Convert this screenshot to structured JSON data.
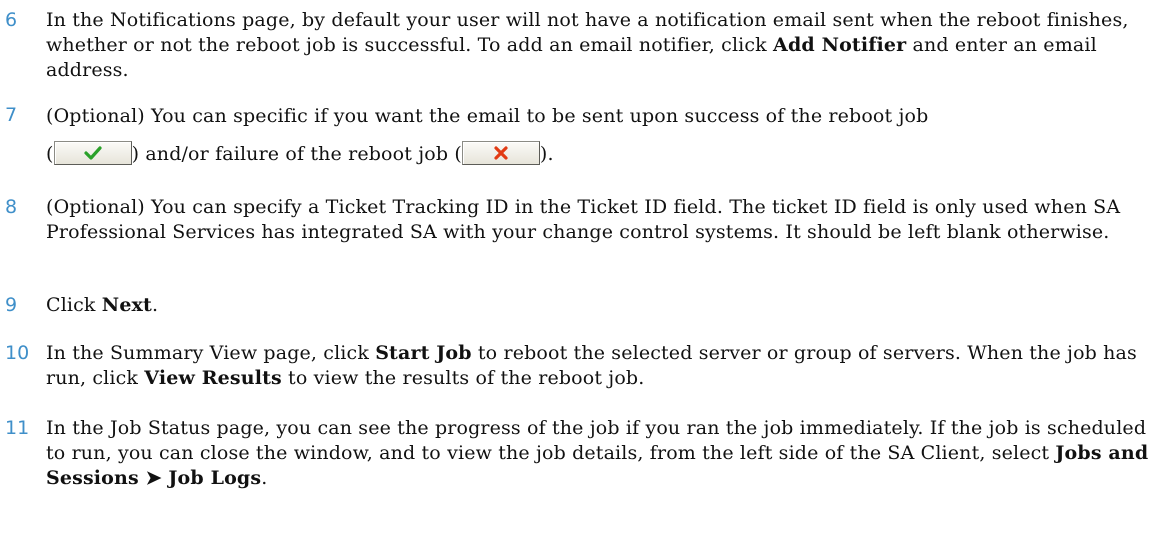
{
  "steps": [
    {
      "number": "6",
      "parts": [
        "In the Notifications page, by default your user will not have a notification email sent when the reboot finishes, whether or not the reboot job is successful. To add an email notifier, click ",
        "Add Notifier",
        " and enter an email address."
      ]
    },
    {
      "number": "7",
      "line1": "(Optional) You can specific if you want the email to be sent upon success of the reboot job",
      "before_success": "(",
      "between": ") and/or failure of the reboot job (",
      "after_failure": ").",
      "success_icon": "checkmark-icon",
      "failure_icon": "x-icon",
      "success_color": "#2aa12a",
      "failure_color": "#e23b14"
    },
    {
      "number": "8",
      "text": "(Optional) You can specify a Ticket Tracking ID in the Ticket ID field. The ticket ID field is only used when SA Professional Services has integrated SA with your change control systems. It should be left blank otherwise."
    },
    {
      "number": "9",
      "parts": [
        "Click ",
        "Next",
        "."
      ]
    },
    {
      "number": "10",
      "parts": [
        "In the Summary View page, click ",
        "Start Job",
        " to reboot the selected server or group of servers. When the job has run, click ",
        "View Results",
        " to view the results of the reboot job."
      ]
    },
    {
      "number": "11",
      "parts": [
        "In the Job Status page, you can see the progress of the job if you ran the job immediately. If the job is scheduled to run, you can close the window, and to view the job details, from the left side of the SA Client, select ",
        "Jobs and Sessions ➤ Job Logs",
        "."
      ]
    }
  ]
}
